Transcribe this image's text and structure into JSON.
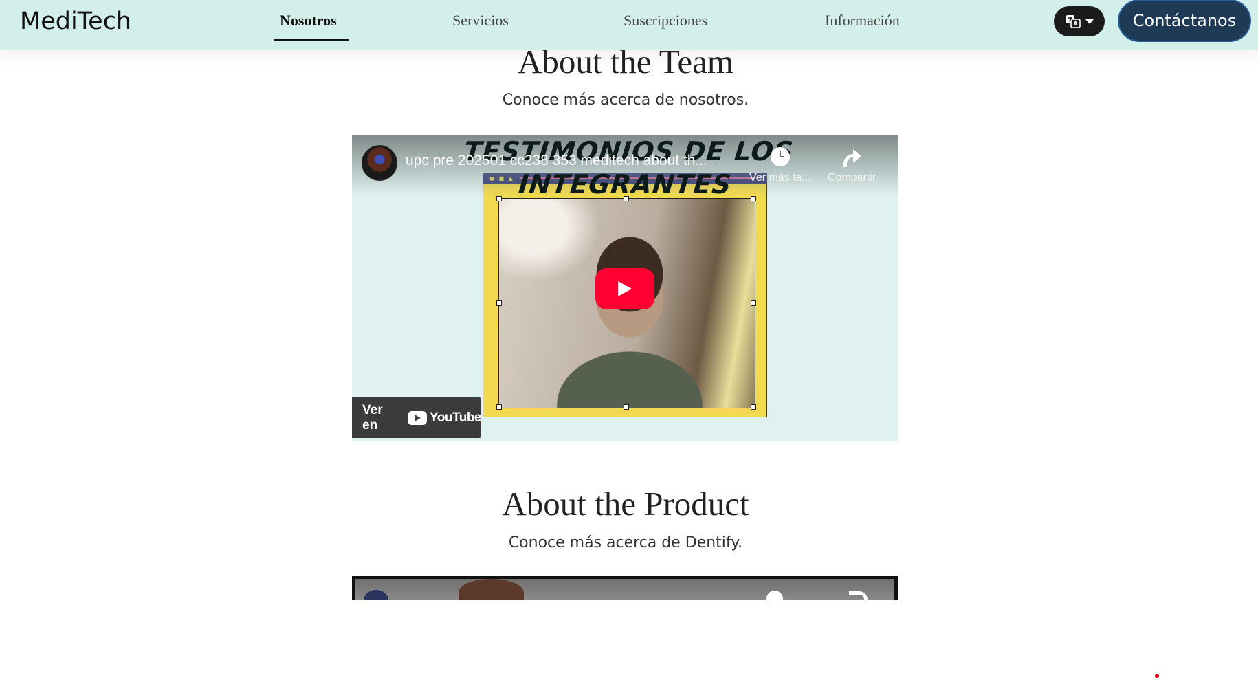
{
  "navbar": {
    "brand": "MediTech",
    "links": [
      {
        "label": "Nosotros",
        "active": true
      },
      {
        "label": "Servicios",
        "active": false
      },
      {
        "label": "Suscripciones",
        "active": false
      },
      {
        "label": "Información",
        "active": false
      }
    ],
    "language_icon": "translate-icon",
    "contact_label": "Contáctanos"
  },
  "team_section": {
    "title": "About the Team",
    "subtitle": "Conoce más acerca de nosotros.",
    "video": {
      "thumbnail_heading": "TESTIMONIOS DE LOS INTEGRANTES",
      "title": "upc pre 202501 cc238 353 meditech about th...",
      "watch_later_label": "Ver más ta...",
      "share_label": "Compartir",
      "watch_on_label": "Ver en",
      "youtube_label": "YouTube"
    }
  },
  "product_section": {
    "title": "About the Product",
    "subtitle": "Conoce más acerca de Dentify."
  },
  "colors": {
    "navbar_bg": "#d3efe9",
    "contact_bg": "#1f3a55",
    "youtube_red": "#ff0033",
    "frame_yellow": "#f1da4f"
  }
}
